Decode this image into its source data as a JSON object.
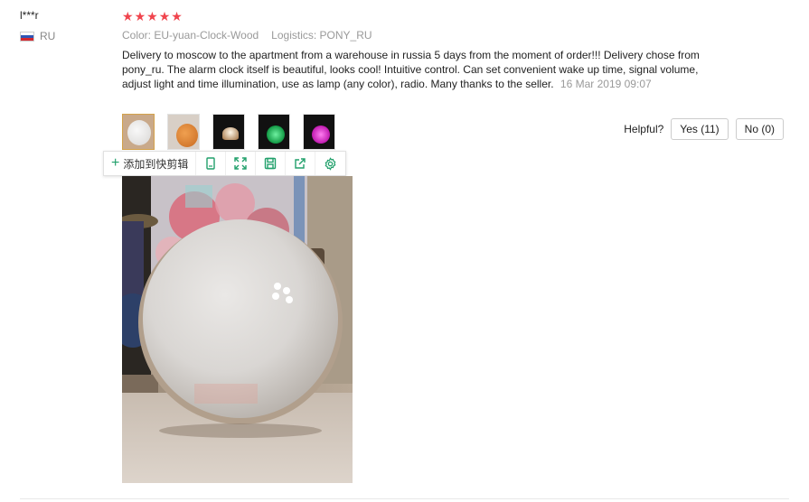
{
  "reviewer": {
    "name": "l***r",
    "country": "RU"
  },
  "rating": {
    "stars": 5,
    "star_glyph": "★",
    "color": "#f0444d"
  },
  "meta": {
    "color": "Color: EU-yuan-Clock-Wood",
    "logistics": "Logistics: PONY_RU"
  },
  "review": {
    "text": "Delivery to moscow to the apartment from a warehouse in russia 5 days from the moment of order!!! Delivery chose from pony_ru. The alarm clock itself is beautiful, looks cool! Intuitive control. Can set convenient wake up time, signal volume, adjust light and time illumination, use as lamp (any color), radio. Many thanks to the seller.",
    "date": "16 Mar 2019 09:07"
  },
  "helpful": {
    "label": "Helpful?",
    "yes": "Yes (11)",
    "no": "No (0)"
  },
  "toolbar": {
    "add_label": "添加到快剪辑",
    "icons": [
      "clip-icon",
      "fullscreen-icon",
      "save-icon",
      "share-icon",
      "settings-icon"
    ],
    "accent": "#21a06b"
  },
  "thumbnails": [
    "white-lamp",
    "orange-lamp",
    "dark-lamp-white-light",
    "green-lamp",
    "pink-lamp"
  ]
}
